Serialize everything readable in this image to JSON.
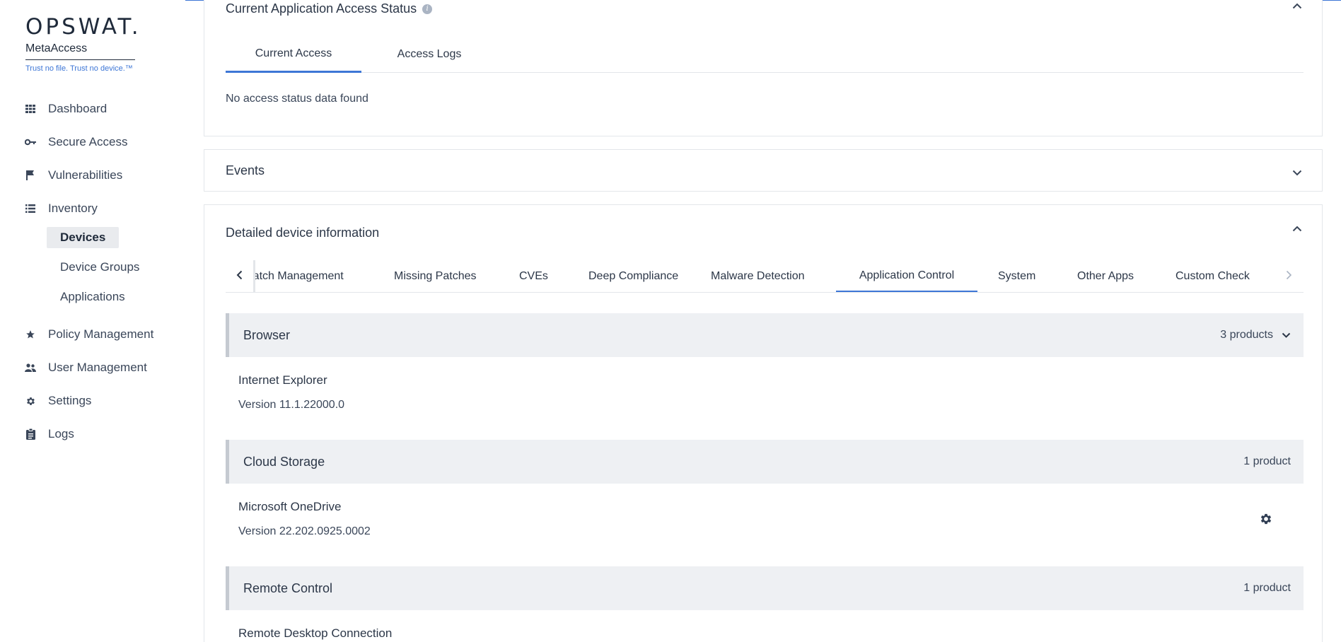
{
  "brand": {
    "logo": "OPSWAT.",
    "product": "MetaAccess",
    "tagline": "Trust no file. Trust no device.™"
  },
  "nav": {
    "items": [
      {
        "label": "Dashboard",
        "icon": "grid-icon"
      },
      {
        "label": "Secure Access",
        "icon": "key-icon"
      },
      {
        "label": "Vulnerabilities",
        "icon": "flag-icon"
      },
      {
        "label": "Inventory",
        "icon": "list-icon"
      },
      {
        "label": "Policy Management",
        "icon": "star-icon"
      },
      {
        "label": "User Management",
        "icon": "people-icon"
      },
      {
        "label": "Settings",
        "icon": "gear-icon"
      },
      {
        "label": "Logs",
        "icon": "clipboard-icon"
      }
    ],
    "inventory_sub": [
      "Devices",
      "Device Groups",
      "Applications"
    ],
    "active_sub": "Devices"
  },
  "access_panel": {
    "title": "Current Application Access Status",
    "tabs": [
      "Current Access",
      "Access Logs"
    ],
    "active_tab": "Current Access",
    "empty_message": "No access status data found"
  },
  "events_panel": {
    "title": "Events"
  },
  "device_panel": {
    "title": "Detailed device information",
    "tabs": [
      "Patch Management",
      "Missing Patches",
      "CVEs",
      "Deep Compliance",
      "Malware Detection",
      "Application Control",
      "System",
      "Other Apps",
      "Custom Check"
    ],
    "active_tab": "Application Control",
    "groups": [
      {
        "name": "Browser",
        "count": "3 products",
        "apps": [
          {
            "name": "Internet Explorer",
            "version": "Version 11.1.22000.0"
          }
        ]
      },
      {
        "name": "Cloud Storage",
        "count": "1 product",
        "apps": [
          {
            "name": "Microsoft OneDrive",
            "version": "Version 22.202.0925.0002"
          }
        ]
      },
      {
        "name": "Remote Control",
        "count": "1 product",
        "apps": [
          {
            "name": "Remote Desktop Connection",
            "version": ""
          }
        ]
      }
    ]
  },
  "colors": {
    "accent": "#3d76d6",
    "text": "#3a4659",
    "group_bg": "#eef0f3"
  }
}
